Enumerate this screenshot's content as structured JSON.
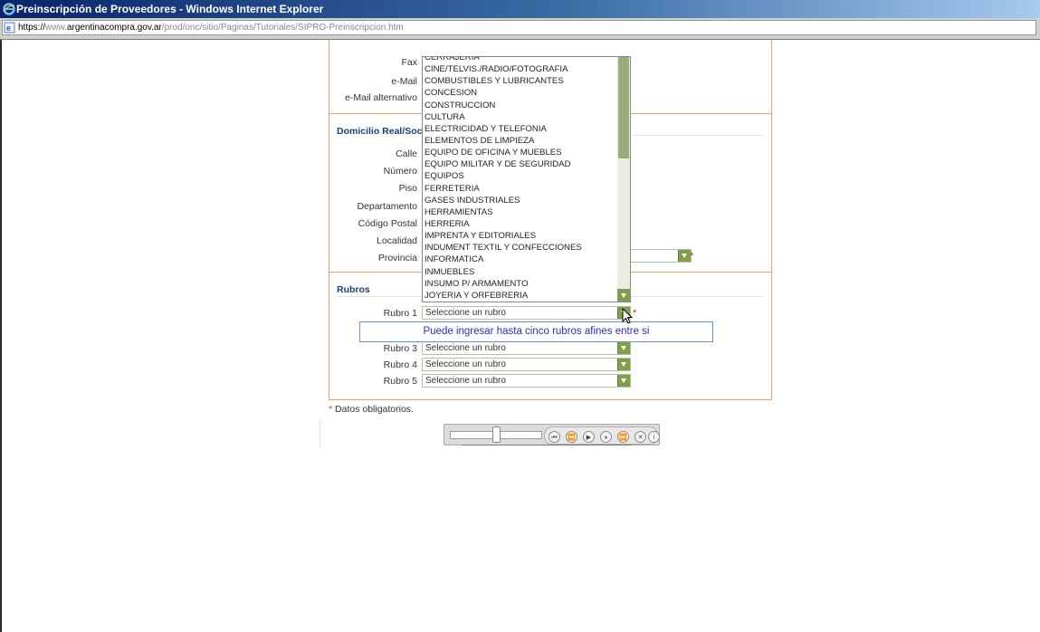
{
  "window": {
    "title": "Preinscripción de Proveedores - Windows Internet Explorer",
    "url_scheme": "https://",
    "url_host_prefix": "www.",
    "url_host": "argentinacompra.gov.ar",
    "url_path": "/prod/onc/sitio/Paginas/Tutoriales/SIPRO-Preinscripcion.htm"
  },
  "contact": {
    "fax_label": "Fax",
    "email_label": "e-Mail",
    "email_alt_label": "e-Mail alternativo"
  },
  "domicilio": {
    "title": "Domicilio Real/Soci",
    "calle": "Calle",
    "numero": "Número",
    "piso": "Piso",
    "departamento": "Departamento",
    "codigo_postal": "Código Postal",
    "localidad": "Localidad",
    "provincia": "Provincia"
  },
  "rubros": {
    "title": "Rubros",
    "rows": [
      {
        "label": "Rubro 1",
        "value": "Seleccione un rubro"
      },
      {
        "label": "Rubro 3",
        "value": "Seleccione un rubro"
      },
      {
        "label": "Rubro 4",
        "value": "Seleccione un rubro"
      },
      {
        "label": "Rubro 5",
        "value": "Seleccione un rubro"
      }
    ]
  },
  "required_mark": "*",
  "footnote": "Datos obligatorios.",
  "dropdown_options": [
    "CERRAJERIA",
    "CINE/TELVIS./RADIO/FOTOGRAFIA",
    "COMBUSTIBLES Y LUBRICANTES",
    "CONCESION",
    "CONSTRUCCION",
    "CULTURA",
    "ELECTRICIDAD Y TELEFONIA",
    "ELEMENTOS DE LIMPIEZA",
    "EQUIPO DE OFICINA Y MUEBLES",
    "EQUIPO MILITAR Y DE SEGURIDAD",
    "EQUIPOS",
    "FERRETERIA",
    "GASES INDUSTRIALES",
    "HERRAMIENTAS",
    "HERRERIA",
    "IMPRENTA Y EDITORIALES",
    "INDUMENT TEXTIL Y CONFECCIONES",
    "INFORMATICA",
    "INMUEBLES",
    "INSUMO P/ ARMAMENTO",
    "JOYERIA Y ORFEBRERIA"
  ],
  "tooltip": "Puede ingresar hasta cinco rubros afines entre si",
  "player": {
    "buttons": [
      "⏮",
      "⏪",
      "▶",
      "⏸",
      "⏩",
      "✕",
      "i"
    ],
    "position": 0.5
  },
  "colors": {
    "accent_orange": "#f3a35f",
    "select_arrow": "#7fa04a",
    "title_blue": "#1c3f7a"
  }
}
